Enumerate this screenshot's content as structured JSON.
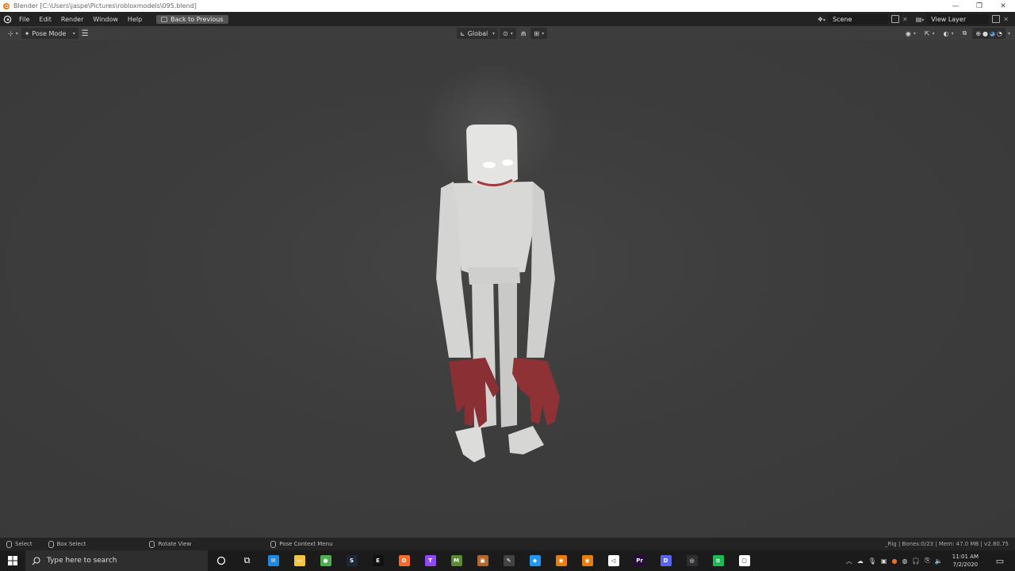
{
  "window": {
    "title": "Blender [C:\\Users\\jaspe\\Pictures\\robloxmodels\\095.blend]",
    "minimize": "—",
    "maximize": "❐",
    "close": "✕"
  },
  "topbar": {
    "menus": [
      "File",
      "Edit",
      "Render",
      "Window",
      "Help"
    ],
    "back_label": "Back to Previous",
    "scene_label": "Scene",
    "view_layer_label": "View Layer"
  },
  "header": {
    "mode_label": "Pose Mode",
    "orientation_label": "Global"
  },
  "status": {
    "select": "Select",
    "box_select": "Box Select",
    "rotate_view": "Rotate View",
    "context_menu": "Pose Context Menu",
    "stats": "_Rig | Bones:0/23 | Mem: 47.0 MB | v2.80.75"
  },
  "taskbar": {
    "search_placeholder": "Type here to search",
    "time": "11:01 AM",
    "date": "7/2/2020",
    "apps": [
      {
        "name": "mail",
        "color": "#1e88e5",
        "glyph": "✉"
      },
      {
        "name": "explorer",
        "color": "#f4c542",
        "glyph": "▭"
      },
      {
        "name": "chrome",
        "color": "#4caf50",
        "glyph": "●"
      },
      {
        "name": "steam",
        "color": "#1b2838",
        "glyph": "S"
      },
      {
        "name": "epic",
        "color": "#111111",
        "glyph": "E"
      },
      {
        "name": "origin",
        "color": "#f56c2d",
        "glyph": "O"
      },
      {
        "name": "twitch",
        "color": "#9146ff",
        "glyph": "T"
      },
      {
        "name": "minecraft",
        "color": "#5b8b32",
        "glyph": "M"
      },
      {
        "name": "blocks",
        "color": "#b5662a",
        "glyph": "▣"
      },
      {
        "name": "tool",
        "color": "#444444",
        "glyph": "✎"
      },
      {
        "name": "roblox-studio",
        "color": "#2196f3",
        "glyph": "◆"
      },
      {
        "name": "blender-a",
        "color": "#e87d0d",
        "glyph": "◉"
      },
      {
        "name": "blender-b",
        "color": "#e87d0d",
        "glyph": "◉"
      },
      {
        "name": "visual-studio",
        "color": "#ffffff",
        "glyph": "◁"
      },
      {
        "name": "premiere",
        "color": "#2a0a3d",
        "glyph": "Pr"
      },
      {
        "name": "discord",
        "color": "#5865f2",
        "glyph": "D"
      },
      {
        "name": "obs",
        "color": "#302e31",
        "glyph": "◎"
      },
      {
        "name": "spotify",
        "color": "#1db954",
        "glyph": "≋"
      },
      {
        "name": "roblox",
        "color": "#ffffff",
        "glyph": "▢"
      }
    ]
  }
}
